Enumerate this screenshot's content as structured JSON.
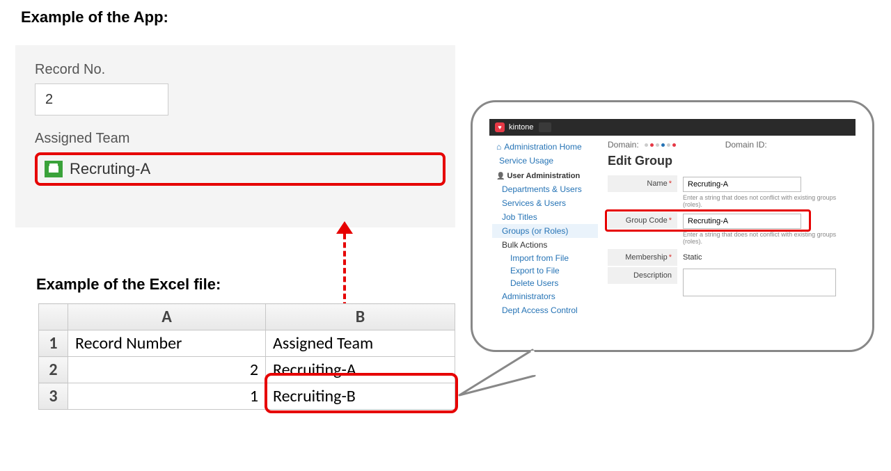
{
  "headings": {
    "app": "Example of the App:",
    "excel": "Example of the Excel file:"
  },
  "app": {
    "record_no_label": "Record No.",
    "record_no_value": "2",
    "assigned_team_label": "Assigned Team",
    "assigned_team_value": "Recruting-A"
  },
  "excel": {
    "col_a": "A",
    "col_b": "B",
    "rows": [
      "1",
      "2",
      "3"
    ],
    "header_a": "Record Number",
    "header_b": "Assigned Team",
    "r2_a": "2",
    "r2_b": "Recruiting-A",
    "r3_a": "1",
    "r3_b": "Recruiting-B"
  },
  "admin": {
    "brand": "kintone",
    "sidebar": {
      "home": "Administration Home",
      "service_usage": "Service Usage",
      "user_admin": "User Administration",
      "departments": "Departments & Users",
      "services": "Services & Users",
      "job_titles": "Job Titles",
      "groups": "Groups (or Roles)",
      "bulk": "Bulk Actions",
      "import": "Import from File",
      "export": "Export to File",
      "delete": "Delete Users",
      "administrators": "Administrators",
      "dept_access": "Dept Access Control"
    },
    "main": {
      "domain_label": "Domain:",
      "domain_id_label": "Domain ID:",
      "title": "Edit Group",
      "name_label": "Name",
      "name_value": "Recruting-A",
      "name_hint": "Enter a string that does not conflict with existing groups (roles).",
      "code_label": "Group Code",
      "code_value": "Recruting-A",
      "code_hint": "Enter a string that does not conflict with existing groups (roles).",
      "membership_label": "Membership",
      "membership_value": "Static",
      "description_label": "Description"
    }
  }
}
